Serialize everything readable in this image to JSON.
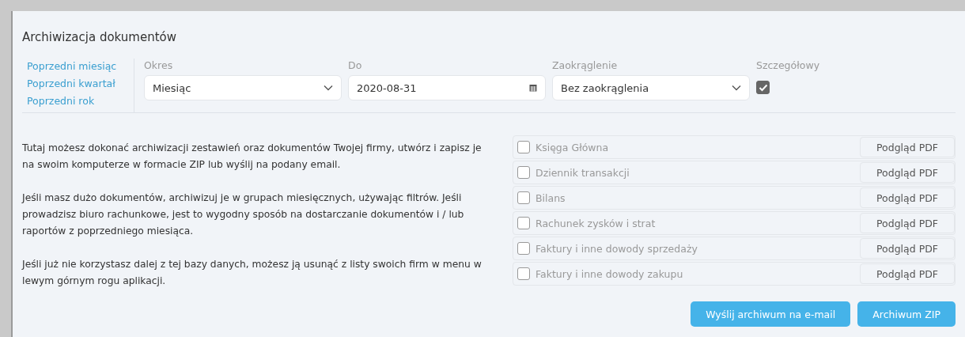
{
  "title": "Archiwizacja dokumentów",
  "quick_links": [
    "Poprzedni miesiąc",
    "Poprzedni kwartał",
    "Poprzedni rok"
  ],
  "filters": [
    {
      "kind": "select",
      "label": "Okres",
      "value": "Miesiąc"
    },
    {
      "kind": "date",
      "label": "Do",
      "value": "2020-08-31"
    },
    {
      "kind": "select",
      "label": "Zaokrąglenie",
      "value": "Bez zaokrąglenia"
    },
    {
      "kind": "checkbox",
      "label": "Szczegółowy",
      "checked": true
    }
  ],
  "paragraphs": [
    "Tutaj możesz dokonać archiwizacji zestawień oraz dokumentów Twojej firmy, utwórz i zapisz je na swoim komputerze w formacie ZIP lub wyślij na podany email.",
    "Jeśli masz dużo dokumentów, archiwizuj je w grupach miesięcznych, używając filtrów. Jeśli prowadzisz biuro rachunkowe, jest to wygodny sposób na dostarczanie dokumentów i / lub raportów z poprzedniego miesiąca.",
    "Jeśli już nie korzystasz dalej z tej bazy danych, możesz ją usunąć z listy swoich firm w menu w lewym górnym rogu aplikacji."
  ],
  "documents": [
    {
      "name": "Księga Główna",
      "checked": false,
      "action": "Podgląd PDF"
    },
    {
      "name": "Dziennik transakcji",
      "checked": false,
      "action": "Podgląd PDF"
    },
    {
      "name": "Bilans",
      "checked": false,
      "action": "Podgląd PDF"
    },
    {
      "name": "Rachunek zysków i strat",
      "checked": false,
      "action": "Podgląd PDF"
    },
    {
      "name": "Faktury i inne dowody sprzedaży",
      "checked": false,
      "action": "Podgląd PDF"
    },
    {
      "name": "Faktury i inne dowody zakupu",
      "checked": false,
      "action": "Podgląd PDF"
    }
  ],
  "buttons": [
    "Wyślij archiwum na e-mail",
    "Archiwum ZIP"
  ]
}
